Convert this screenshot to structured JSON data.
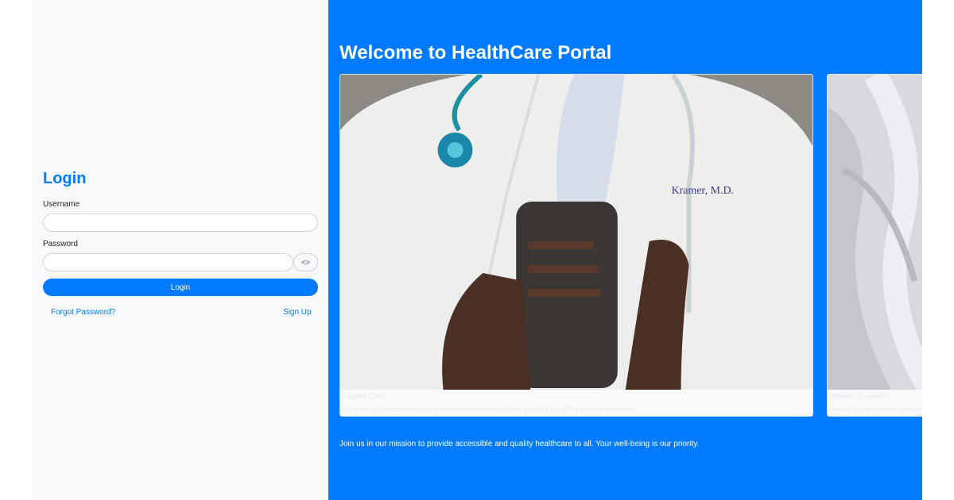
{
  "login": {
    "title": "Login",
    "username_label": "Username",
    "username_value": "",
    "password_label": "Password",
    "password_value": "",
    "show_password_icon": "eye-icon",
    "submit_label": "Login",
    "forgot_password": "Forgot Password?",
    "sign_up": "Sign Up"
  },
  "welcome": {
    "title": "Welcome to HealthCare Portal",
    "cards": [
      {
        "image": "doctor-with-phone-photo",
        "title": "Expert Care",
        "text": "Our team of dedicated healthcare professionals is committed to providing you with the best possible care."
      },
      {
        "image": "patient-bed-photo",
        "title": "Modern Facilities",
        "text": "State-of-the-art medical facilities and equipment"
      }
    ],
    "footer": "Join us in our mission to provide accessible and quality healthcare to all. Your well-being is our priority."
  },
  "colors": {
    "primary": "#007bff",
    "panel_bg": "#f8f9fa",
    "white": "#ffffff"
  }
}
